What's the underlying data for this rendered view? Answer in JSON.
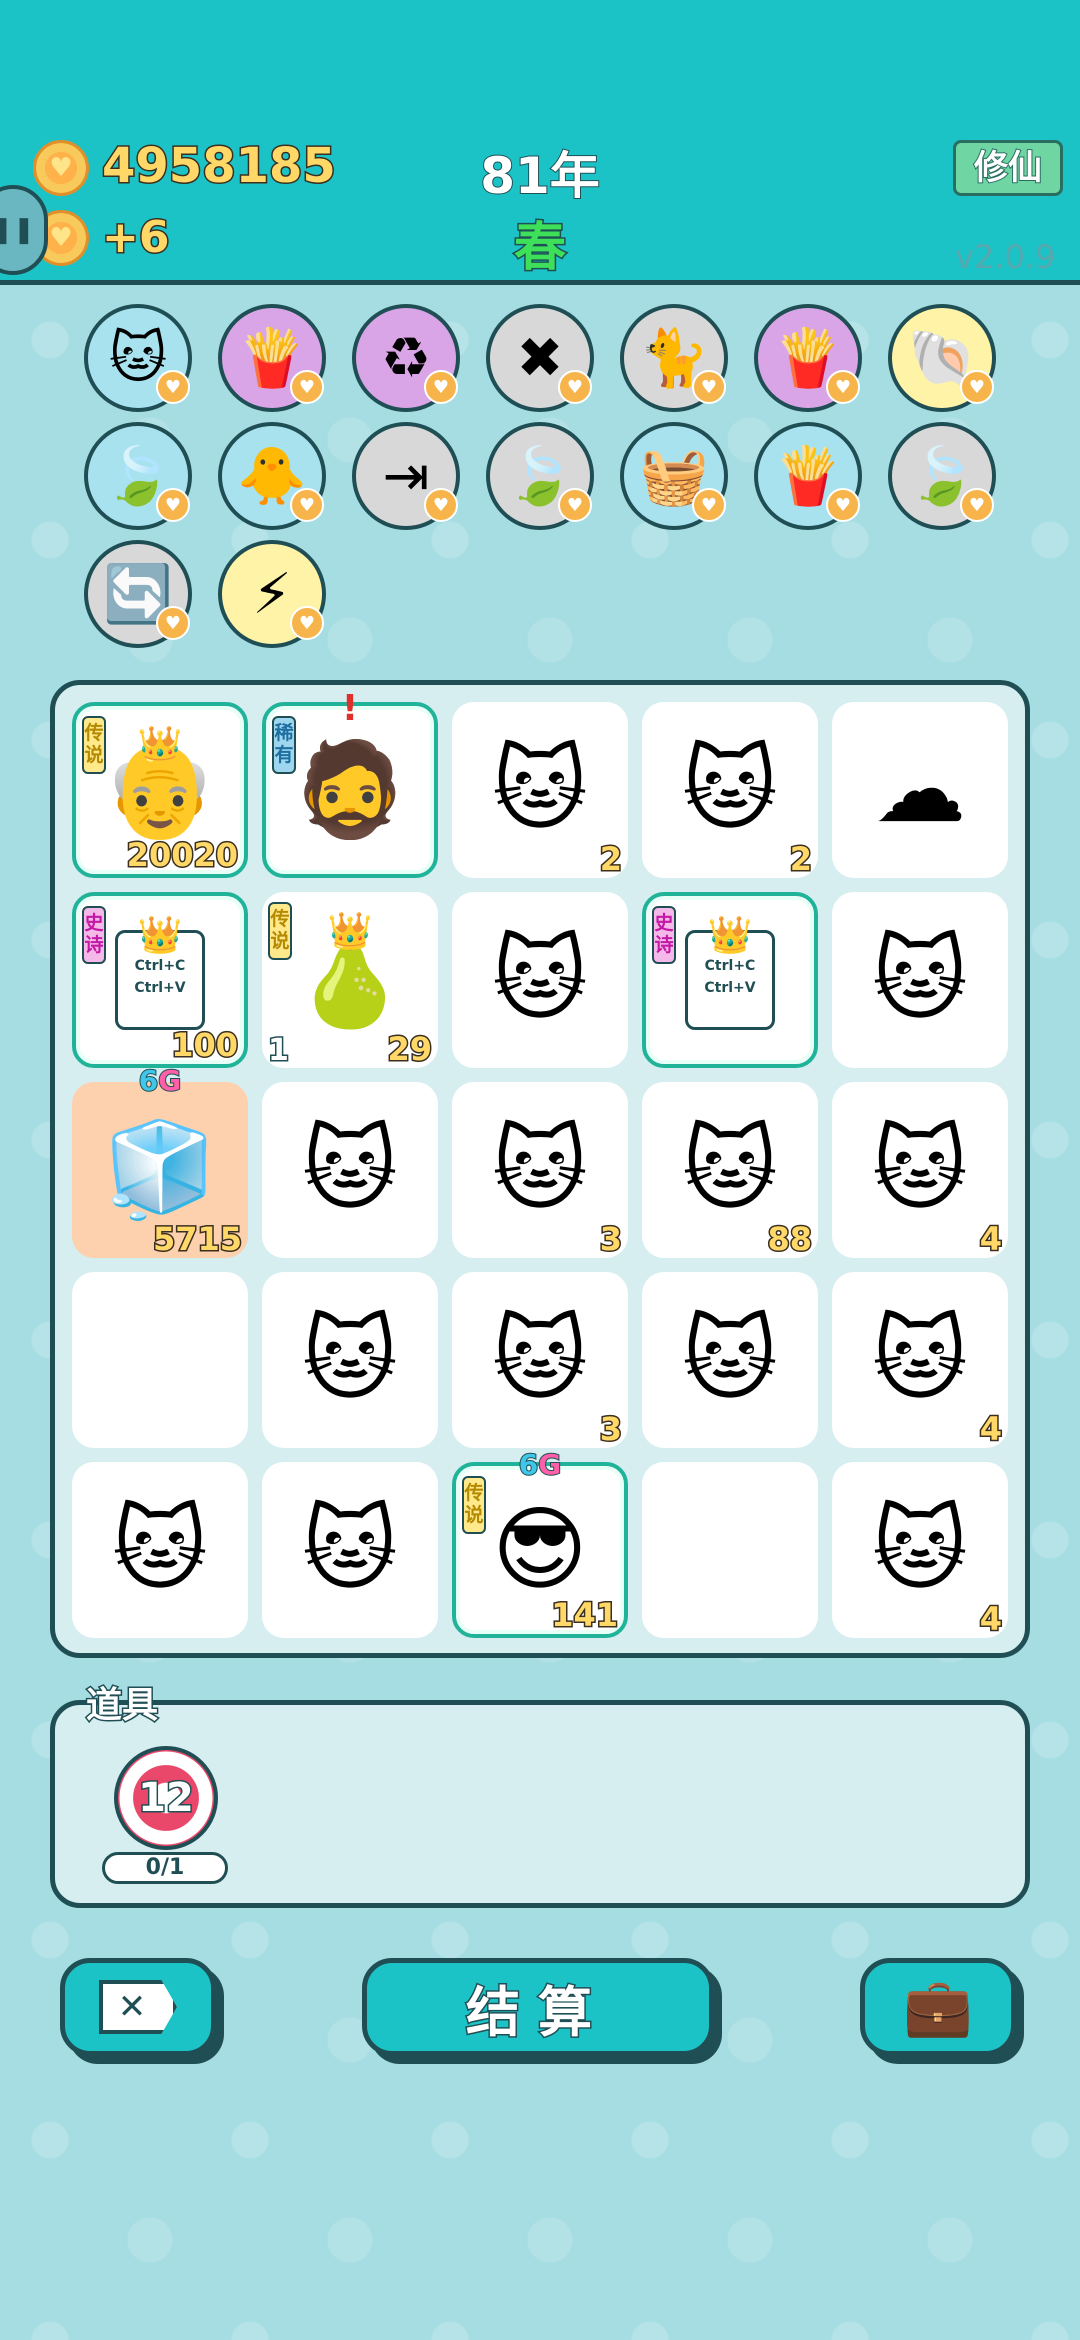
{
  "header": {
    "coins": "4958185",
    "income": "+6",
    "year": "81年",
    "season": "春",
    "xiuxian_label": "修仙",
    "version": "v2.0.9"
  },
  "symbols_bar": [
    {
      "name": "cat-icon",
      "glyph": "🐱",
      "bg": "#a9e2ef"
    },
    {
      "name": "fries-icon",
      "glyph": "🍟",
      "bg": "#d9a5e6"
    },
    {
      "name": "recycle-icon",
      "glyph": "♻",
      "bg": "#d9a5e6"
    },
    {
      "name": "remove-tag-icon",
      "glyph": "✖",
      "bg": "#d8d8d8"
    },
    {
      "name": "cats-pair-icon",
      "glyph": "🐈",
      "bg": "#d8d8d8"
    },
    {
      "name": "fries-icon",
      "glyph": "🍟",
      "bg": "#d9a5e6"
    },
    {
      "name": "shell-icon",
      "glyph": "🐚",
      "bg": "#fff3a8"
    },
    {
      "name": "leaf-icon",
      "glyph": "🍃",
      "bg": "#a9e2ef"
    },
    {
      "name": "chick-icon",
      "glyph": "🐥",
      "bg": "#a9e2ef"
    },
    {
      "name": "skip-icon",
      "glyph": "⇥",
      "bg": "#d8d8d8"
    },
    {
      "name": "leaf-icon",
      "glyph": "🍃",
      "bg": "#d8d8d8"
    },
    {
      "name": "fruit-basket-icon",
      "glyph": "🧺",
      "bg": "#a9e2ef"
    },
    {
      "name": "fries-icon",
      "glyph": "🍟",
      "bg": "#a9e2ef"
    },
    {
      "name": "leaf-icon",
      "glyph": "🍃",
      "bg": "#d8d8d8"
    },
    {
      "name": "refresh-icon",
      "glyph": "🔄",
      "bg": "#d8d8d8"
    },
    {
      "name": "lightning-icon",
      "glyph": "⚡",
      "bg": "#fff3a8"
    }
  ],
  "board": [
    {
      "glyph": "👴",
      "tag": "传说",
      "tagType": "legend",
      "count": "20020",
      "crown": true,
      "rare": true
    },
    {
      "glyph": "🧔",
      "tag": "稀有",
      "tagType": "rare",
      "alert": true,
      "rare": true
    },
    {
      "glyph": "🐱",
      "count": "2"
    },
    {
      "glyph": "🐱",
      "count": "2"
    },
    {
      "glyph": "☁"
    },
    {
      "card": true,
      "tag": "史诗",
      "tagType": "epic",
      "count": "100",
      "crown": true,
      "rare": true
    },
    {
      "glyph": "🍐",
      "tag": "传说",
      "tagType": "legend",
      "count": "29",
      "lcount": "1",
      "crown": true
    },
    {
      "glyph": "🐱"
    },
    {
      "card": true,
      "tag": "史诗",
      "tagType": "epic",
      "crown": true,
      "rare": true
    },
    {
      "glyph": "🐱"
    },
    {
      "glyph": "🧊",
      "gtag": "6",
      "gsuffix": "G",
      "count": "5715",
      "orange": true
    },
    {
      "glyph": "🐱"
    },
    {
      "glyph": "🐱",
      "count": "3"
    },
    {
      "glyph": "🐱",
      "count": "88"
    },
    {
      "glyph": "🐱",
      "count": "4"
    },
    {
      "empty": true
    },
    {
      "glyph": "🐱"
    },
    {
      "glyph": "🐱",
      "count": "3"
    },
    {
      "glyph": "🐱"
    },
    {
      "glyph": "🐱",
      "count": "4"
    },
    {
      "glyph": "🐱"
    },
    {
      "glyph": "🐱"
    },
    {
      "glyph": "😎",
      "tag": "传说",
      "tagType": "legend",
      "gtag": "6",
      "gsuffix": "G",
      "count": "141",
      "rare": true
    },
    {
      "empty": true
    },
    {
      "glyph": "🐱",
      "count": "4"
    }
  ],
  "card_text": {
    "line1": "Ctrl+C",
    "line2": "Ctrl+V"
  },
  "items": {
    "title": "道具",
    "dart_value": "12",
    "dart_uses": "0/1"
  },
  "buttons": {
    "settle_label": "结算"
  }
}
